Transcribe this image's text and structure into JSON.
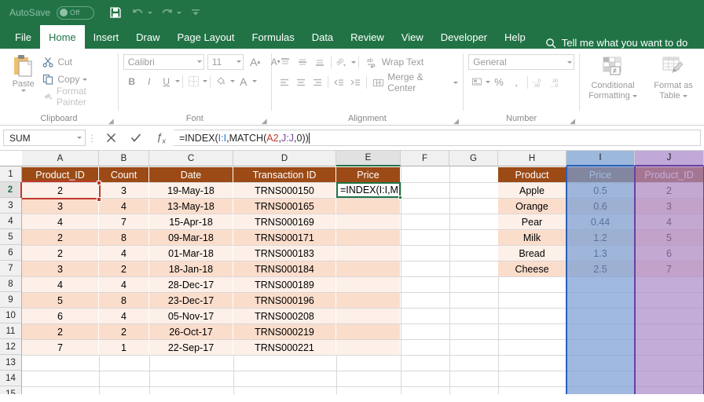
{
  "titlebar": {
    "autosave_label": "AutoSave",
    "autosave_state": "Off",
    "icons": [
      "save-icon",
      "undo-icon",
      "redo-icon",
      "customize-qat-icon"
    ]
  },
  "ribbon_tabs": [
    {
      "label": "File",
      "active": false
    },
    {
      "label": "Home",
      "active": true
    },
    {
      "label": "Insert",
      "active": false
    },
    {
      "label": "Draw",
      "active": false
    },
    {
      "label": "Page Layout",
      "active": false
    },
    {
      "label": "Formulas",
      "active": false
    },
    {
      "label": "Data",
      "active": false
    },
    {
      "label": "Review",
      "active": false
    },
    {
      "label": "View",
      "active": false
    },
    {
      "label": "Developer",
      "active": false
    },
    {
      "label": "Help",
      "active": false
    }
  ],
  "tell_me": "Tell me what you want to do",
  "ribbon": {
    "clipboard": {
      "group_label": "Clipboard",
      "paste_label": "Paste",
      "cut_label": "Cut",
      "copy_label": "Copy",
      "format_painter_label": "Format Painter"
    },
    "font": {
      "group_label": "Font",
      "font_name": "Calibri",
      "font_size": "11",
      "bold_label": "B",
      "italic_label": "I",
      "underline_label": "U",
      "grow_font_label": "A",
      "shrink_font_label": "A",
      "font_color_label": "A"
    },
    "alignment": {
      "group_label": "Alignment",
      "wrap_text_label": "Wrap Text",
      "merge_center_label": "Merge & Center"
    },
    "number": {
      "group_label": "Number",
      "format": "General",
      "percent_label": "%",
      "comma_label": ",",
      "decrease_decimal_label": ".00",
      "increase_decimal_label": ".00"
    },
    "styles": {
      "conditional_formatting_line1": "Conditional",
      "conditional_formatting_line2": "Formatting",
      "format_as_table_line1": "Format as",
      "format_as_table_line2": "Table"
    }
  },
  "formula_bar": {
    "name_box": "SUM",
    "cancel_icon": "close-icon",
    "enter_icon": "check-icon",
    "insert_function_icon": "fx-icon",
    "formula_parts": [
      {
        "text": "=INDEX(",
        "color": "black"
      },
      {
        "text": "I:I",
        "color": "blue"
      },
      {
        "text": ",MATCH(",
        "color": "black"
      },
      {
        "text": "A2",
        "color": "red"
      },
      {
        "text": ",",
        "color": "black"
      },
      {
        "text": "J:J",
        "color": "purple"
      },
      {
        "text": ",0))",
        "color": "black"
      }
    ]
  },
  "grid": {
    "columns": [
      "A",
      "B",
      "C",
      "D",
      "E",
      "F",
      "G",
      "H",
      "I",
      "J"
    ],
    "rows": [
      "1",
      "2",
      "3",
      "4",
      "5",
      "6",
      "7",
      "8",
      "9",
      "10",
      "11",
      "12",
      "13",
      "14",
      "15"
    ],
    "selected_column": "E",
    "highlighted_columns": {
      "I": "#2b5fb8",
      "J": "#6b3fa0"
    },
    "active_cell_ref": "E2",
    "active_cell_text": "=INDEX(I:I,M",
    "marching_ants_cell": "A2",
    "table_left": {
      "headers": [
        "Product_ID",
        "Count",
        "Date",
        "Transaction ID",
        "Price"
      ],
      "rows": [
        [
          "2",
          "3",
          "19-May-18",
          "TRNS000150",
          ""
        ],
        [
          "3",
          "4",
          "13-May-18",
          "TRNS000165",
          ""
        ],
        [
          "4",
          "7",
          "15-Apr-18",
          "TRNS000169",
          ""
        ],
        [
          "2",
          "8",
          "09-Mar-18",
          "TRNS000171",
          ""
        ],
        [
          "2",
          "4",
          "01-Mar-18",
          "TRNS000183",
          ""
        ],
        [
          "3",
          "2",
          "18-Jan-18",
          "TRNS000184",
          ""
        ],
        [
          "4",
          "4",
          "28-Dec-17",
          "TRNS000189",
          ""
        ],
        [
          "5",
          "8",
          "23-Dec-17",
          "TRNS000196",
          ""
        ],
        [
          "6",
          "4",
          "05-Nov-17",
          "TRNS000208",
          ""
        ],
        [
          "2",
          "2",
          "26-Oct-17",
          "TRNS000219",
          ""
        ],
        [
          "7",
          "1",
          "22-Sep-17",
          "TRNS000221",
          ""
        ]
      ]
    },
    "table_right": {
      "headers": [
        "Product",
        "Price",
        "Product_ID"
      ],
      "rows": [
        [
          "Apple",
          "0.5",
          "2"
        ],
        [
          "Orange",
          "0.6",
          "3"
        ],
        [
          "Pear",
          "0.44",
          "4"
        ],
        [
          "Milk",
          "1.2",
          "5"
        ],
        [
          "Bread",
          "1.3",
          "6"
        ],
        [
          "Cheese",
          "2.5",
          "7"
        ]
      ]
    }
  },
  "colors": {
    "excel_green": "#217346",
    "header_brown": "#9c4a16",
    "band_light": "#fdf0e9",
    "band_dark": "#fbddcc",
    "ref_blue": "#1f77d0",
    "ref_red": "#c0392b",
    "ref_purple": "#7b3fa0"
  }
}
